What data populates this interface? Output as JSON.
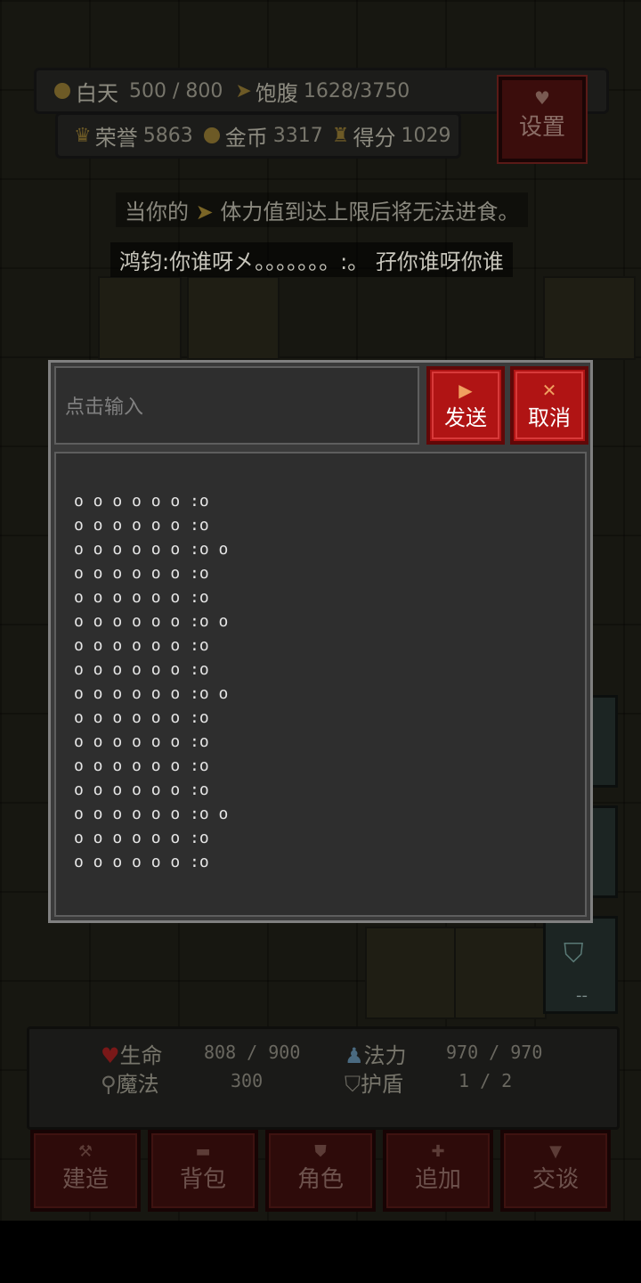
{
  "status": {
    "day_label": "白天",
    "day_value": "500 / 800",
    "satiety_label": "饱腹",
    "satiety_value": "1628/3750",
    "honor_label": "荣誉",
    "honor_value": "5863",
    "gold_label": "金币",
    "gold_value": "3317",
    "score_label": "得分",
    "score_value": "1029"
  },
  "settings_label": "设置",
  "messages": {
    "tip_prefix": "当你的",
    "tip_suffix": "体力值到达上限后将无法进食。",
    "chat": "鸿钧:你谁呀㐅。。。。。。。:。 孖你谁呀你谁"
  },
  "dialog": {
    "placeholder": "点击输入",
    "send_label": "发送",
    "cancel_label": "取消",
    "lines": [
      "o o o o o o :o",
      "o o o o o o :o",
      "o o o o o o :o o",
      "o o o o o o :o",
      "o o o o o o :o",
      "o o o o o o :o o",
      "o o o o o o :o",
      "o o o o o o :o",
      "o o o o o o :o o",
      "o o o o o o :o",
      "o o o o o o :o",
      "o o o o o o :o",
      "o o o o o o :o",
      "o o o o o o :o o",
      "o o o o o o :o",
      "o o o o o o :o"
    ]
  },
  "player": {
    "life_label": "生命",
    "life_value": "808 / 900",
    "mana_label": "法力",
    "mana_value": "970 / 970",
    "magic_label": "魔法",
    "magic_value": "300",
    "shield_label": "护盾",
    "shield_value": "1 / 2"
  },
  "side_slots": {
    "shield_slot_value": "--"
  },
  "menu": [
    "建造",
    "背包",
    "角色",
    "追加",
    "交谈"
  ],
  "icons": {
    "send": "triangle-right-icon",
    "cancel": "x-icon",
    "settings": "heart-icon",
    "menu": [
      "hammer-icon",
      "bag-icon",
      "shield-icon",
      "plus-icon",
      "speech-bubble-icon"
    ]
  },
  "colors": {
    "accent_red": "#b01414",
    "panel": "#2e2e2e"
  }
}
